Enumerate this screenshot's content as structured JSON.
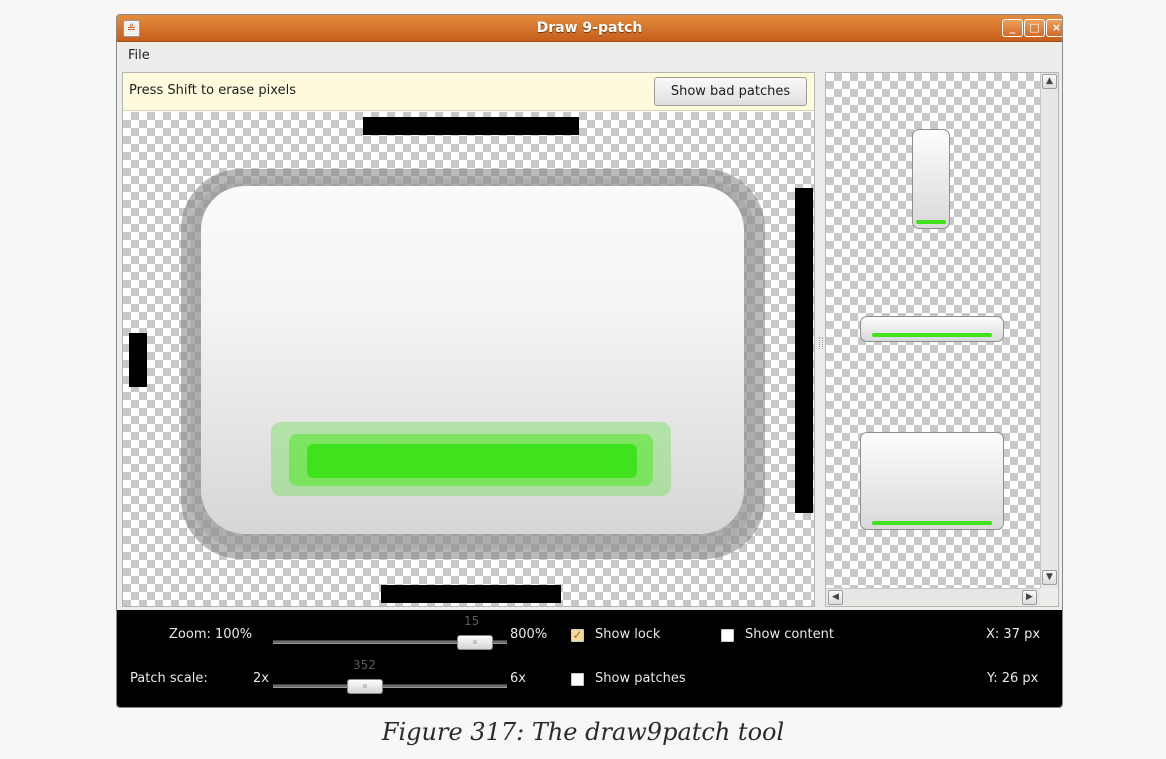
{
  "window": {
    "title": "Draw 9-patch",
    "app_icon_glyph": "≗",
    "controls": {
      "minimize": "_",
      "maximize": "□",
      "close": "×"
    }
  },
  "menubar": {
    "file": "File"
  },
  "editor": {
    "hint": "Press Shift to erase pixels",
    "bad_patches_button": "Show bad patches"
  },
  "controls": {
    "zoom_label": "Zoom: 100%",
    "zoom_max": "800%",
    "zoom_value": "15",
    "patch_scale_label": "Patch scale:",
    "patch_min": "2x",
    "patch_max": "6x",
    "patch_value": "352",
    "show_lock": "Show lock",
    "show_lock_checked": true,
    "show_content": "Show content",
    "show_content_checked": false,
    "show_patches": "Show patches",
    "show_patches_checked": false,
    "x_coord": "X: 37 px",
    "y_coord": "Y: 26 px"
  },
  "caption": "Figure 317: The draw9patch tool",
  "colors": {
    "titlebar": "#d4742e",
    "hint_bg": "#fefbdd",
    "content_green": "#3fe21c",
    "patch_black": "#000000"
  }
}
